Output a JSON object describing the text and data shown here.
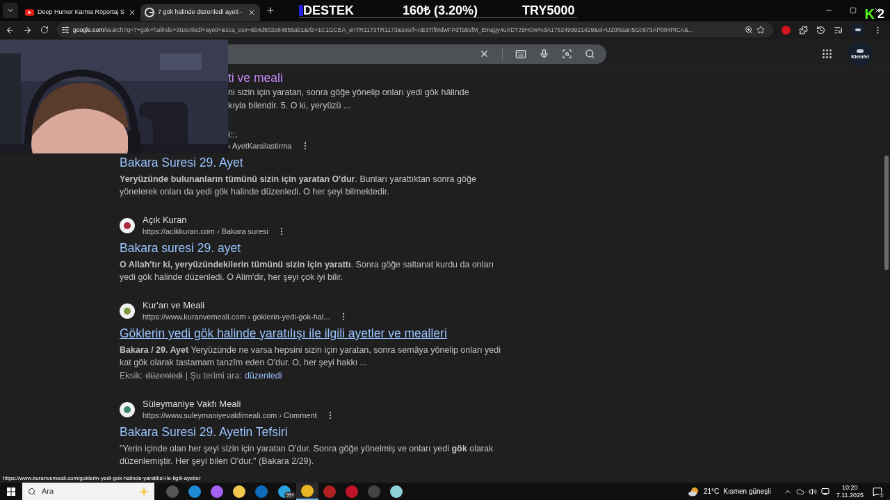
{
  "browser": {
    "tabs": [
      {
        "title": "Deep Humor Karma Röportaj S",
        "kind": "video",
        "selected": false
      },
      {
        "title": "7 gök halinde düzenledi ayeti -",
        "kind": "search",
        "selected": true
      }
    ],
    "address": {
      "domain": "google.com",
      "path": "/search?q=7+gök+halinde+düzenledi+ayeti+&sca_esv=6b4d902e84856ab1&rlz=1C1GCEA_enTR1173TR1173&sxsrf=AE3TifMdwFPdTa5sfM_Emqgy4uXDTz9HOw%3A1762499921429&ei=UZ0Naan5Gc673AP004PICA&..."
    }
  },
  "stream_overlay": {
    "label": "DESTEK",
    "amount": "160₺ (3.20%)",
    "goal": "TRY5000",
    "logo": "K",
    "count": "2"
  },
  "google_header": {
    "avatar_label": "Kleinfel"
  },
  "results": [
    {
      "kind": "clipped",
      "title": "ti ve meali",
      "visited": true,
      "snippet_lines": [
        "ni sizin için yaratan, sonra göğe yönelip onları yedi gök hâlinde",
        "kıyla bilendir. 5. O ki, yeryüzü ..."
      ]
    },
    {
      "kind": "partial_head",
      "site": "i::.",
      "url": "› AyetKarsilastirma",
      "title": "Bakara Suresi 29. Ayet",
      "visited": false,
      "hovered": false,
      "snippet": "**Yeryüzünde bulunanların tümünü sizin için yaratan O'dur**. Bunları yarattıktan sonra göğe yönelerek onları da yedi gök halinde düzenledi. O her şeyi bilmektedir."
    },
    {
      "kind": "full",
      "site": "Açık Kuran",
      "url": "https://acikkuran.com › Bakara suresi",
      "title": "Bakara suresi 29. ayet",
      "visited": false,
      "hovered": false,
      "snippet": "**O Allah'tır ki, yeryüzündekilerin tümünü sizin için yarattı**. Sonra göğe saltanat kurdu da onları yedi gök halinde düzenledi. O Alim'dir, her şeyi çok iyi bilir."
    },
    {
      "kind": "full",
      "site": "Kur'an ve Meali",
      "url": "https://www.kuranvemeali.com › goklerin-yedi-gok-hal...",
      "title": "Göklerin yedi gök halinde yaratılışı ile ilgili ayetler ve mealleri",
      "visited": false,
      "hovered": true,
      "snippet": "**Bakara / 29. Ayet** Yeryüzünde ne varsa hepsini sizin için yaratan, sonra semâya yönelip onları yedi kat gök olarak tastamam tanzîm eden O'dur. O, her şeyi hakkı ...",
      "missing": {
        "prefix": "Eksik:",
        "struck": "düzenledi",
        "middle": "| Şu terimi ara:",
        "link": "düzenledi"
      }
    },
    {
      "kind": "full",
      "site": "Süleymaniye Vakfı Meali",
      "url": "https://www.suleymaniyevakfimeali.com › Comment",
      "title": "Bakara Suresi 29. Ayetin Tefsiri",
      "visited": false,
      "hovered": false,
      "snippet": "\"Yerin içinde olan her şeyi sizin için yaratan O'dur. Sonra göğe yönelmiş ve onları yedi **gök** olarak düzenlemiştir. Her şeyi bilen O'dur.\" (Bakara 2/29)."
    }
  ],
  "status_url": "https://www.kuranvemeali.com/goklerin-yedi-gok-halinde-yaratilisi-ile-ilgili-ayetler",
  "taskbar": {
    "search_placeholder": "Ara",
    "badge": "99+",
    "weather_temp": "21°C",
    "weather_text": "Kısmen güneşli",
    "time": "10:20",
    "date": "7.11.2025",
    "notifications": "1"
  }
}
